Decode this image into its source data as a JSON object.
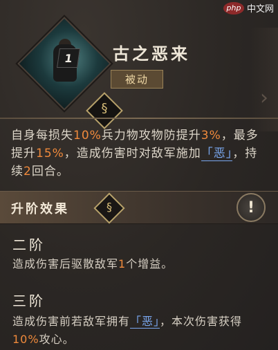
{
  "skill": {
    "level": "1",
    "title": "古之恶来",
    "type_tag": "被动",
    "desc": {
      "p1": "自身每损失",
      "v1": "10%",
      "p2": "兵力物攻物防提升",
      "v2": "3%",
      "p3": "，最多提升",
      "v3": "15%",
      "p4": "，造成伤害时对敌军施加",
      "status": "「恶」",
      "p5": "，持续",
      "v4": "2",
      "p6": "回合。"
    }
  },
  "upgrade": {
    "label": "升阶效果",
    "info_icon": "!"
  },
  "tiers": [
    {
      "title": "二阶",
      "t1": "造成伤害后驱散敌军",
      "v": "1",
      "t2": "个增益。"
    },
    {
      "title": "三阶",
      "t1": "造成伤害前若敌军拥有",
      "status": "「恶」",
      "t2": "，本次伤害获得",
      "v": "10%",
      "t3": "攻心。"
    }
  ],
  "watermark": {
    "logo": "php",
    "text": "中文网"
  },
  "colors": {
    "highlight": "#f08a3c",
    "status": "#7aa8f0",
    "gold": "#b8a26b"
  }
}
